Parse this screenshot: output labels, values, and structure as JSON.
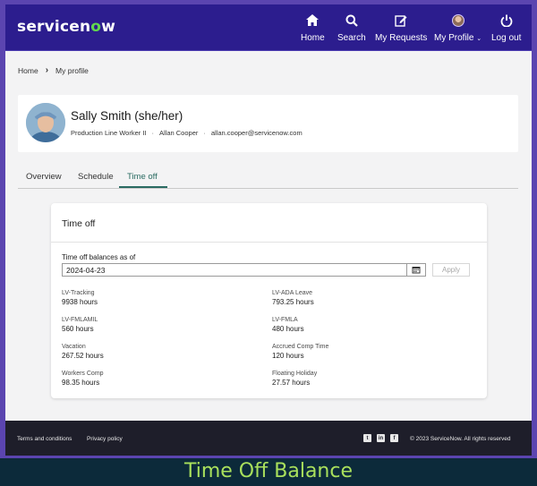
{
  "header": {
    "brand": "servicenow",
    "nav": [
      {
        "label": "Home",
        "icon": "home-icon"
      },
      {
        "label": "Search",
        "icon": "search-icon"
      },
      {
        "label": "My Requests",
        "icon": "edit-icon"
      },
      {
        "label": "My Profile",
        "icon": "avatar"
      },
      {
        "label": "Log out",
        "icon": "power-icon"
      }
    ]
  },
  "breadcrumb": [
    "Home",
    "My profile"
  ],
  "profile": {
    "name": "Sally Smith (she/her)",
    "title": "Production Line Worker II",
    "manager": "Allan Cooper",
    "email": "allan.cooper@servicenow.com"
  },
  "tabs": [
    "Overview",
    "Schedule",
    "Time off"
  ],
  "time_off": {
    "title": "Time off",
    "balances_label": "Time off balances as of",
    "date_value": "2024-04-23",
    "apply_label": "Apply",
    "balances": [
      {
        "label": "LV-Tracking",
        "value": "9938 hours"
      },
      {
        "label": "LV-ADA Leave",
        "value": "793.25 hours"
      },
      {
        "label": "LV-FMLAMIL",
        "value": "560 hours"
      },
      {
        "label": "LV-FMLA",
        "value": "480 hours"
      },
      {
        "label": "Vacation",
        "value": "267.52 hours"
      },
      {
        "label": "Accrued Comp Time",
        "value": "120 hours"
      },
      {
        "label": "Workers Comp",
        "value": "98.35 hours"
      },
      {
        "label": "Floating Holiday",
        "value": "27.57 hours"
      }
    ]
  },
  "footer": {
    "links": [
      "Terms and conditions",
      "Privacy policy"
    ],
    "social": [
      "twitter-icon",
      "linkedin-icon",
      "facebook-icon"
    ],
    "copyright": "© 2023 ServiceNow.  All rights reserved"
  },
  "caption": "Time Off Balance",
  "colors": {
    "header_bg": "#2c1d8e",
    "frame": "#5b45b0",
    "accent_tab": "#2a6b62",
    "caption": "#a9e05c",
    "brand_green": "#62d84e"
  }
}
